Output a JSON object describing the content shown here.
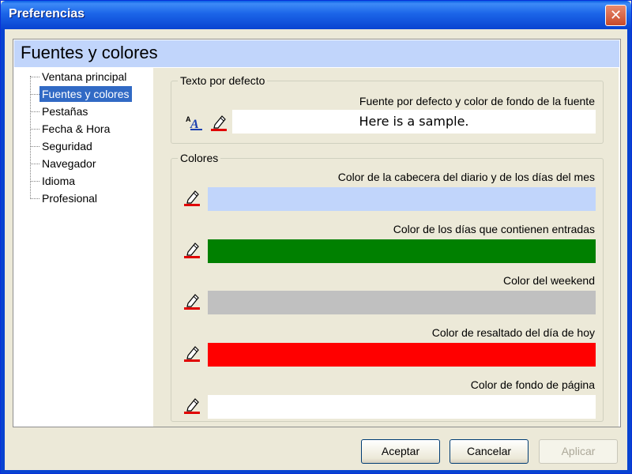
{
  "window": {
    "title": "Preferencias",
    "close_glyph": "✕"
  },
  "header": {
    "title": "Fuentes y colores"
  },
  "sidebar": {
    "items": [
      {
        "label": "Ventana principal"
      },
      {
        "label": "Fuentes y colores",
        "selected": true
      },
      {
        "label": "Pestañas"
      },
      {
        "label": "Fecha & Hora"
      },
      {
        "label": "Seguridad"
      },
      {
        "label": "Navegador"
      },
      {
        "label": "Idioma"
      },
      {
        "label": "Profesional"
      }
    ]
  },
  "default_text": {
    "legend": "Texto por defecto",
    "label": "Fuente por defecto y color de fondo de la fuente",
    "sample": "Here is a sample."
  },
  "colors": {
    "legend": "Colores",
    "items": [
      {
        "label": "Color de la cabecera del diario y de los días del mes",
        "color": "#c1d5fb"
      },
      {
        "label": "Color de los días que contienen entradas",
        "color": "#008000"
      },
      {
        "label": "Color del weekend",
        "color": "#c0c0c0"
      },
      {
        "label": "Color de resaltado del día de hoy",
        "color": "#ff0000"
      },
      {
        "label": "Color de fondo de página",
        "color": "#ffffff"
      }
    ]
  },
  "buttons": {
    "accept": "Aceptar",
    "cancel": "Cancelar",
    "apply": "Aplicar"
  },
  "icons": {
    "font": "font-icon",
    "pencil": "pencil-icon"
  }
}
